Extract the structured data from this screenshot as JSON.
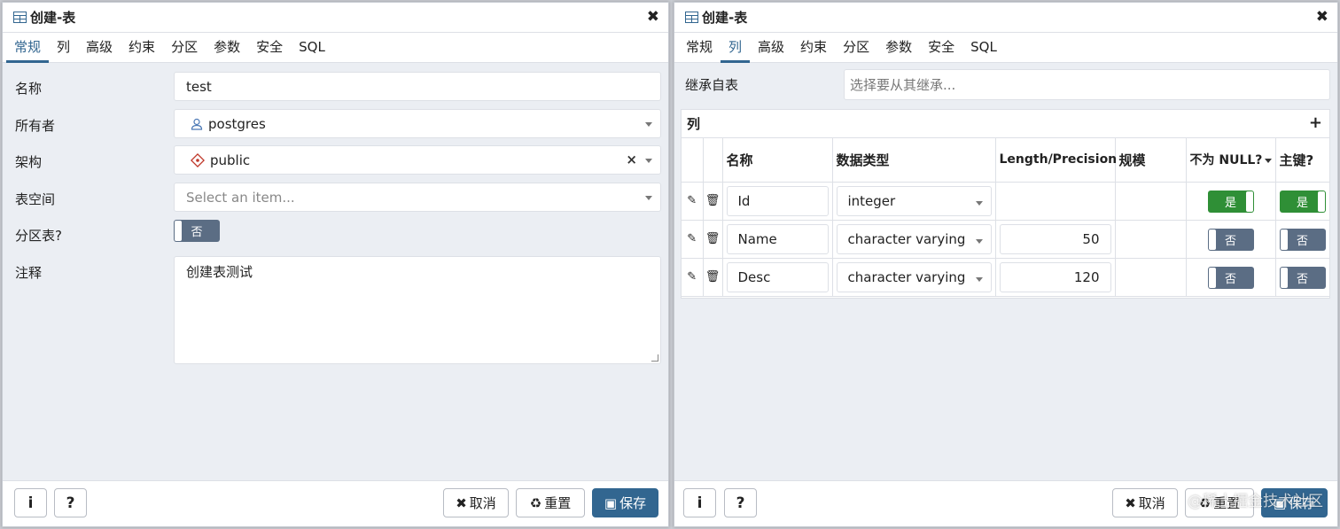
{
  "left": {
    "title": "创建-表",
    "tabs": [
      "常规",
      "列",
      "高级",
      "约束",
      "分区",
      "参数",
      "安全",
      "SQL"
    ],
    "fields": {
      "name_label": "名称",
      "name_value": "test",
      "owner_label": "所有者",
      "owner_value": "postgres",
      "schema_label": "架构",
      "schema_value": "public",
      "tablespace_label": "表空间",
      "tablespace_placeholder": "Select an item...",
      "partitioned_label": "分区表?",
      "partitioned_value": "否",
      "comment_label": "注释",
      "comment_value": "创建表测试"
    },
    "footer": {
      "info": "i",
      "help": "?",
      "cancel": "取消",
      "reset": "重置",
      "save": "保存"
    }
  },
  "right": {
    "title": "创建-表",
    "tabs": [
      "常规",
      "列",
      "高级",
      "约束",
      "分区",
      "参数",
      "安全",
      "SQL"
    ],
    "inherit_label": "继承自表",
    "inherit_placeholder": "选择要从其继承...",
    "columns_title": "列",
    "add": "+",
    "headers": {
      "name": "名称",
      "type": "数据类型",
      "length": "Length/Precision",
      "scale": "规模",
      "notnull": "不为 NULL?",
      "pk": "主键?"
    },
    "rows": [
      {
        "name": "Id",
        "type": "integer",
        "length": "",
        "scale": "",
        "notnull": "是",
        "pk": "是"
      },
      {
        "name": "Name",
        "type": "character varying",
        "length": "50",
        "scale": "",
        "notnull": "否",
        "pk": "否"
      },
      {
        "name": "Desc",
        "type": "character varying",
        "length": "120",
        "scale": "",
        "notnull": "否",
        "pk": "否"
      }
    ],
    "footer": {
      "info": "i",
      "help": "?",
      "cancel": "取消",
      "reset": "重置",
      "save": "保存"
    },
    "watermark": "@稀土掘金技术社区"
  },
  "colors": {
    "accent": "#326690",
    "toggle_on": "#2f8f36",
    "toggle_off": "#5b6d84"
  }
}
